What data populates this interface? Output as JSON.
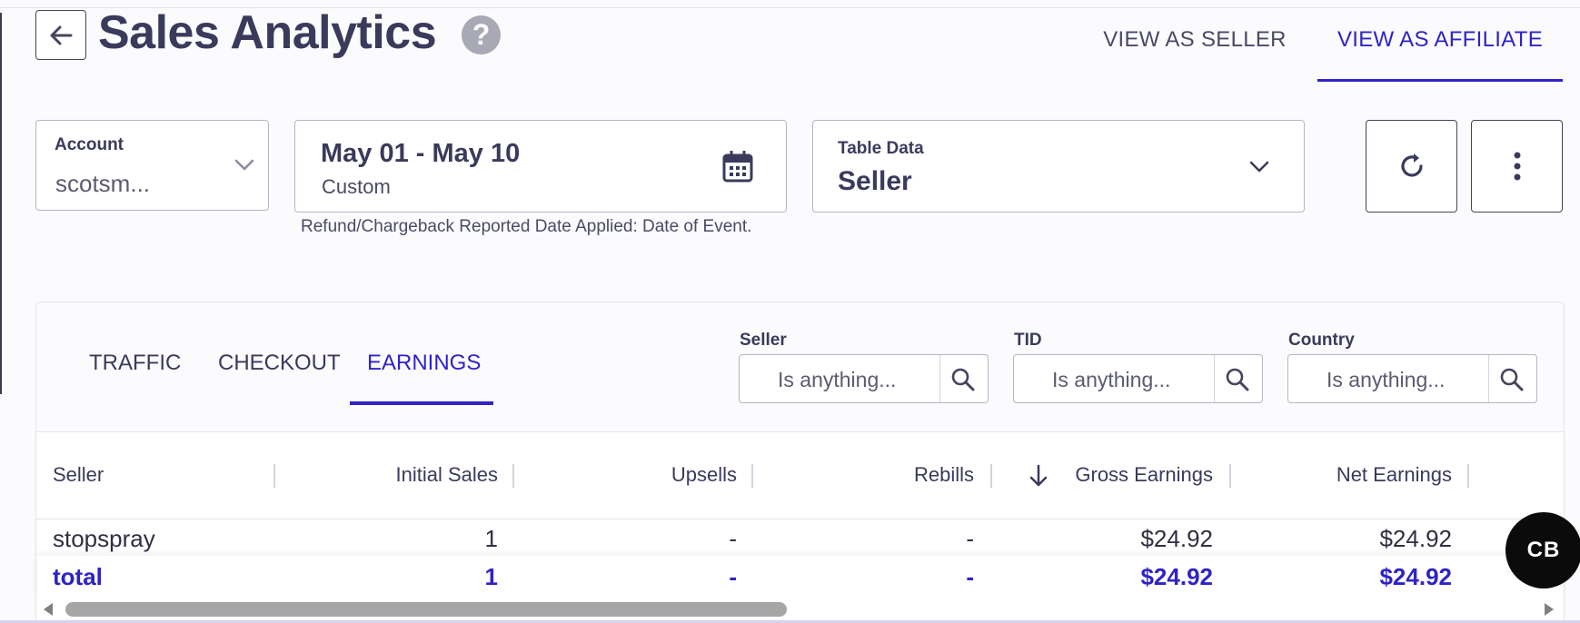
{
  "header": {
    "title": "Sales Analytics",
    "help_glyph": "?",
    "view_tabs": [
      {
        "label": "VIEW AS SELLER",
        "active": false
      },
      {
        "label": "VIEW AS AFFILIATE",
        "active": true
      }
    ]
  },
  "filters": {
    "account": {
      "label": "Account",
      "value": "scotsm..."
    },
    "date": {
      "range": "May 01 - May 10",
      "preset": "Custom",
      "note": "Refund/Chargeback Reported Date Applied: Date of Event."
    },
    "table_data": {
      "label": "Table Data",
      "value": "Seller"
    }
  },
  "report": {
    "tabs": [
      {
        "label": "TRAFFIC",
        "active": false
      },
      {
        "label": "CHECKOUT",
        "active": false
      },
      {
        "label": "EARNINGS",
        "active": true
      }
    ],
    "column_filters": [
      {
        "label": "Seller",
        "placeholder": "Is anything..."
      },
      {
        "label": "TID",
        "placeholder": "Is anything..."
      },
      {
        "label": "Country",
        "placeholder": "Is anything..."
      }
    ],
    "table": {
      "columns": [
        "Seller",
        "Initial Sales",
        "Upsells",
        "Rebills",
        "Gross Earnings",
        "Net Earnings"
      ],
      "sorted_column": "Gross Earnings",
      "sort_direction": "descending",
      "rows": [
        [
          "stopspray",
          "1",
          "-",
          "-",
          "$24.92",
          "$24.92"
        ]
      ],
      "total": [
        "total",
        "1",
        "-",
        "-",
        "$24.92",
        "$24.92"
      ]
    }
  },
  "badge": {
    "text": "CB"
  },
  "colors": {
    "accent": "#2e23c7",
    "text": "#3a3a5c",
    "border": "#b5b5c5"
  }
}
